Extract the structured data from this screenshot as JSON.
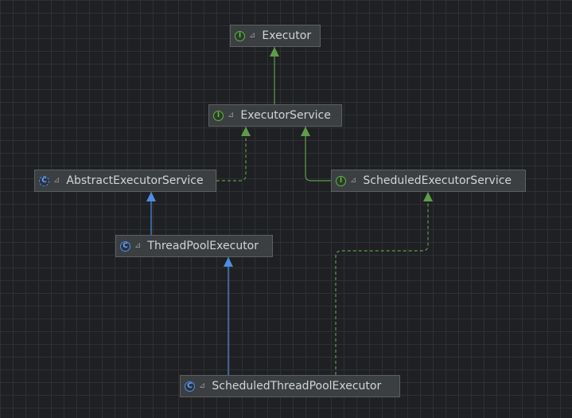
{
  "diagram": {
    "nodes": [
      {
        "id": "executor",
        "label": "Executor",
        "kind": "interface",
        "kind_glyph": "I",
        "access_glyph": "⊿"
      },
      {
        "id": "executor-service",
        "label": "ExecutorService",
        "kind": "interface",
        "kind_glyph": "I",
        "access_glyph": "⊿"
      },
      {
        "id": "abstract-executor-service",
        "label": "AbstractExecutorService",
        "kind": "abstract-class",
        "kind_glyph": "C",
        "access_glyph": "⊿"
      },
      {
        "id": "scheduled-executor-service",
        "label": "ScheduledExecutorService",
        "kind": "interface",
        "kind_glyph": "I",
        "access_glyph": "⊿"
      },
      {
        "id": "thread-pool-executor",
        "label": "ThreadPoolExecutor",
        "kind": "class",
        "kind_glyph": "C",
        "access_glyph": "⊿"
      },
      {
        "id": "scheduled-thread-pool-executor",
        "label": "ScheduledThreadPoolExecutor",
        "kind": "class",
        "kind_glyph": "C",
        "access_glyph": "⊿"
      }
    ],
    "edges": [
      {
        "from": "executor-service",
        "to": "executor",
        "type": "interface-extends"
      },
      {
        "from": "abstract-executor-service",
        "to": "executor-service",
        "type": "implements"
      },
      {
        "from": "scheduled-executor-service",
        "to": "executor-service",
        "type": "interface-extends"
      },
      {
        "from": "thread-pool-executor",
        "to": "abstract-executor-service",
        "type": "extends"
      },
      {
        "from": "scheduled-thread-pool-executor",
        "to": "thread-pool-executor",
        "type": "extends"
      },
      {
        "from": "scheduled-thread-pool-executor",
        "to": "scheduled-executor-service",
        "type": "implements"
      }
    ],
    "colors": {
      "background": "#1f2023",
      "grid": "#2e3033",
      "node_fill": "#3c3f41",
      "node_border": "#5d6063",
      "label_text": "#d2d4d6",
      "interface_edge": "#5e9c4a",
      "class_edge": "#4d8fe0"
    }
  }
}
